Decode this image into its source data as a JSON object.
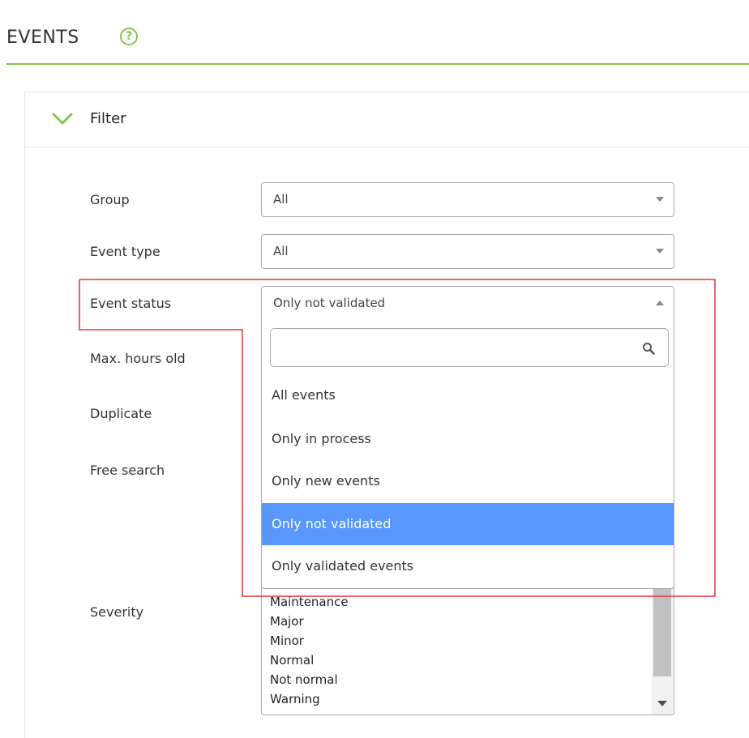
{
  "header": {
    "title": "EVENTS"
  },
  "filter": {
    "title": "Filter"
  },
  "fields": {
    "group": {
      "label": "Group",
      "value": "All"
    },
    "event_type": {
      "label": "Event type",
      "value": "All"
    },
    "event_status": {
      "label": "Event status",
      "value": "Only not validated"
    },
    "max_hours_old": {
      "label": "Max. hours old"
    },
    "duplicate": {
      "label": "Duplicate"
    },
    "free_search": {
      "label": "Free search"
    },
    "severity": {
      "label": "Severity"
    }
  },
  "dropdown": {
    "search_value": "",
    "options": [
      "All events",
      "Only in process",
      "Only new events",
      "Only not validated",
      "Only validated events"
    ],
    "selected_index": 3
  },
  "severity_list": {
    "items": [
      "Maintenance",
      "Major",
      "Minor",
      "Normal",
      "Not normal",
      "Warning"
    ]
  },
  "colors": {
    "accent": "#8cc152",
    "selected": "#5897fb",
    "highlight": "#e5323a"
  }
}
